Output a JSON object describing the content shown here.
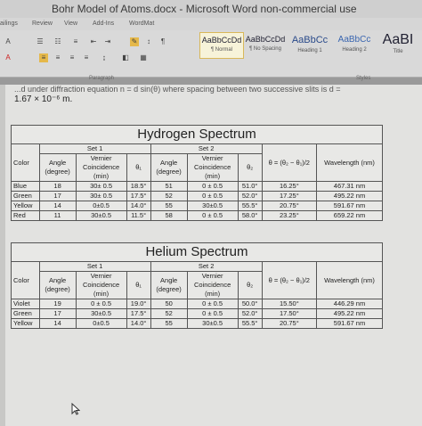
{
  "window": {
    "title": "Bohr Model of Atoms.docx - Microsoft Word non-commercial use"
  },
  "menu": [
    "ailings",
    "Review",
    "View",
    "Add-Ins",
    "WordMat"
  ],
  "ribbon": {
    "paragraph_label": "Paragraph",
    "styles_label": "Styles",
    "styles": [
      {
        "sample": "AaBbCcDd",
        "name": "¶ Normal"
      },
      {
        "sample": "AaBbCcDd",
        "name": "¶ No Spacing"
      },
      {
        "sample": "AaBbCc",
        "name": "Heading 1"
      },
      {
        "sample": "AaBbCc",
        "name": "Heading 2"
      },
      {
        "sample": "AaBI",
        "name": "Title"
      }
    ]
  },
  "document": {
    "line1": "...d under diffraction equation n = d sin(θ) where spacing between two successive slits is d =",
    "line2": "1.67 × 10⁻⁶ m."
  },
  "hydrogen": {
    "title": "Hydrogen Spectrum",
    "col_color": "Color",
    "set1": "Set 1",
    "set2": "Set 2",
    "angle": "Angle (degree)",
    "vernier": "Vernier Coincidence (min)",
    "theta1": "θ₁",
    "theta2": "θ₂",
    "formula": "θ = (θ₂ − θ₁)/2",
    "wavelength": "Wavelength (nm)",
    "rows": [
      [
        "Blue",
        "18",
        "30± 0.5",
        "18.5°",
        "51",
        "0 ± 0.5",
        "51.0°",
        "16.25°",
        "467.31 nm"
      ],
      [
        "Green",
        "17",
        "30± 0.5",
        "17.5°",
        "52",
        "0 ± 0.5",
        "52.0°",
        "17.25°",
        "495.22 nm"
      ],
      [
        "Yellow",
        "14",
        "0±0.5",
        "14.0°",
        "55",
        "30±0.5",
        "55.5°",
        "20.75°",
        "591.67 nm"
      ],
      [
        "Red",
        "11",
        "30±0.5",
        "11.5°",
        "58",
        "0 ± 0.5",
        "58.0°",
        "23.25°",
        "659.22 nm"
      ]
    ]
  },
  "helium": {
    "title": "Helium Spectrum",
    "col_color": "Color",
    "set1": "Set 1",
    "set2": "Set 2",
    "angle": "Angle (degree)",
    "vernier": "Vernier Coincidence (min)",
    "theta1": "θ₁",
    "theta2": "θ₂",
    "formula": "θ = (θ₂ − θ₁)/2",
    "wavelength": "Wavelength (nm)",
    "rows": [
      [
        "Violet",
        "19",
        "0 ± 0.5",
        "19.0°",
        "50",
        "0 ± 0.5",
        "50.0°",
        "15.50°",
        "446.29 nm"
      ],
      [
        "Green",
        "17",
        "30±0.5",
        "17.5°",
        "52",
        "0 ± 0.5",
        "52.0°",
        "17.50°",
        "495.22 nm"
      ],
      [
        "Yellow",
        "14",
        "0±0.5",
        "14.0°",
        "55",
        "30±0.5",
        "55.5°",
        "20.75°",
        "591.67 nm"
      ]
    ]
  }
}
